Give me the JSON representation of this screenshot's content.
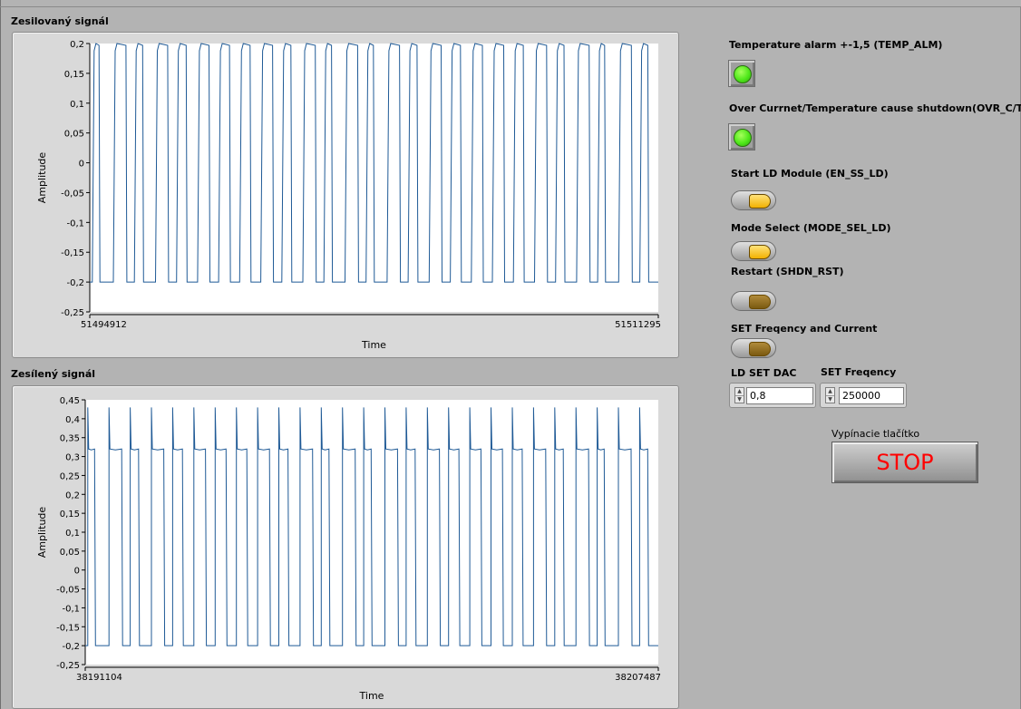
{
  "chart_data": [
    {
      "type": "line",
      "title": "Zesilovaný signál",
      "xlabel": "Time",
      "ylabel": "Amplitude",
      "xlim": [
        51494912,
        51511295
      ],
      "ylim": [
        -0.25,
        0.2
      ],
      "yticks": [
        "0,2",
        "0,15",
        "0,1",
        "0,05",
        "0",
        "-0,05",
        "-0,1",
        "-0,15",
        "-0,2",
        "-0,25"
      ],
      "xticks": [
        "51494912",
        "51511295"
      ],
      "series_color": "#1f5a96",
      "waveform": "square wave, approx. 0.2 high / -0.2 low, ~27 pulses of varying width",
      "high": 0.2,
      "low": -0.2,
      "grid": false
    },
    {
      "type": "line",
      "title": "Zesílený signál",
      "xlabel": "Time",
      "ylabel": "Amplitude",
      "xlim": [
        38191104,
        38207487
      ],
      "ylim": [
        -0.25,
        0.45
      ],
      "yticks": [
        "0,45",
        "0,4",
        "0,35",
        "0,3",
        "0,25",
        "0,2",
        "0,15",
        "0,1",
        "0,05",
        "0",
        "-0,05",
        "-0,1",
        "-0,15",
        "-0,2",
        "-0,25"
      ],
      "xticks": [
        "38191104",
        "38207487"
      ],
      "series_color": "#1f5a96",
      "waveform": "square wave ~0.32 high / -0.2 low with spikes to ~0.43, ~27 pulses",
      "high": 0.32,
      "low": -0.2,
      "spike": 0.43,
      "grid": false
    }
  ],
  "indicators": {
    "temp_alarm": {
      "label": "Temperature alarm +-1,5 (TEMP_ALM)",
      "state": "on",
      "color": "#4fe81a"
    },
    "ovr": {
      "label": "Over Currnet/Temperature  cause shutdown(OVR_C/T)",
      "state": "on",
      "color": "#4fe81a"
    }
  },
  "switches": {
    "en_ss_ld": {
      "label": "Start LD Module (EN_SS_LD)",
      "state": "on"
    },
    "mode_sel": {
      "label": "Mode Select (MODE_SEL_LD)",
      "state": "on"
    },
    "shdn_rst": {
      "label": "Restart (SHDN_RST)",
      "state": "off"
    },
    "set_freq_current": {
      "label": "SET Freqency and Current",
      "state": "off"
    }
  },
  "controls": {
    "ld_set_dac": {
      "label": "LD  SET  DAC",
      "value": "0,8"
    },
    "set_freq": {
      "label": "SET Freqency",
      "value": "250000"
    }
  },
  "stop": {
    "caption": "Vypínacie tlačítko",
    "label": "STOP",
    "text_color": "#ff0000"
  }
}
